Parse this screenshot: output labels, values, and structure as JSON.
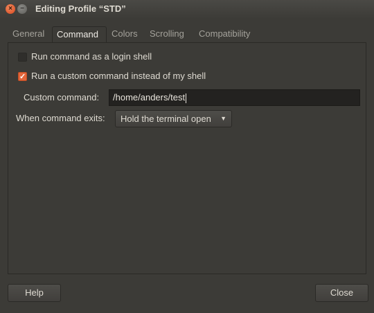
{
  "window": {
    "title": "Editing Profile “STD”",
    "close_glyph": "×",
    "minimize_glyph": "−"
  },
  "tabs": [
    {
      "label": "General",
      "active": false
    },
    {
      "label": "Command",
      "active": true
    },
    {
      "label": "Colors",
      "active": false
    },
    {
      "label": "Scrolling",
      "active": false
    },
    {
      "label": "Compatibility",
      "active": false
    }
  ],
  "command": {
    "login_shell_label": "Run command as a login shell",
    "login_shell_checked": false,
    "custom_command_toggle_label": "Run a custom command instead of my shell",
    "custom_command_toggle_checked": true,
    "custom_command_label": "Custom command:",
    "custom_command_value": "/home/anders/test",
    "exit_label": "When command exits:",
    "exit_selected": "Hold the terminal open"
  },
  "footer": {
    "help_label": "Help",
    "close_label": "Close"
  },
  "colors": {
    "accent": "#e2663b",
    "background": "#3c3b37"
  }
}
